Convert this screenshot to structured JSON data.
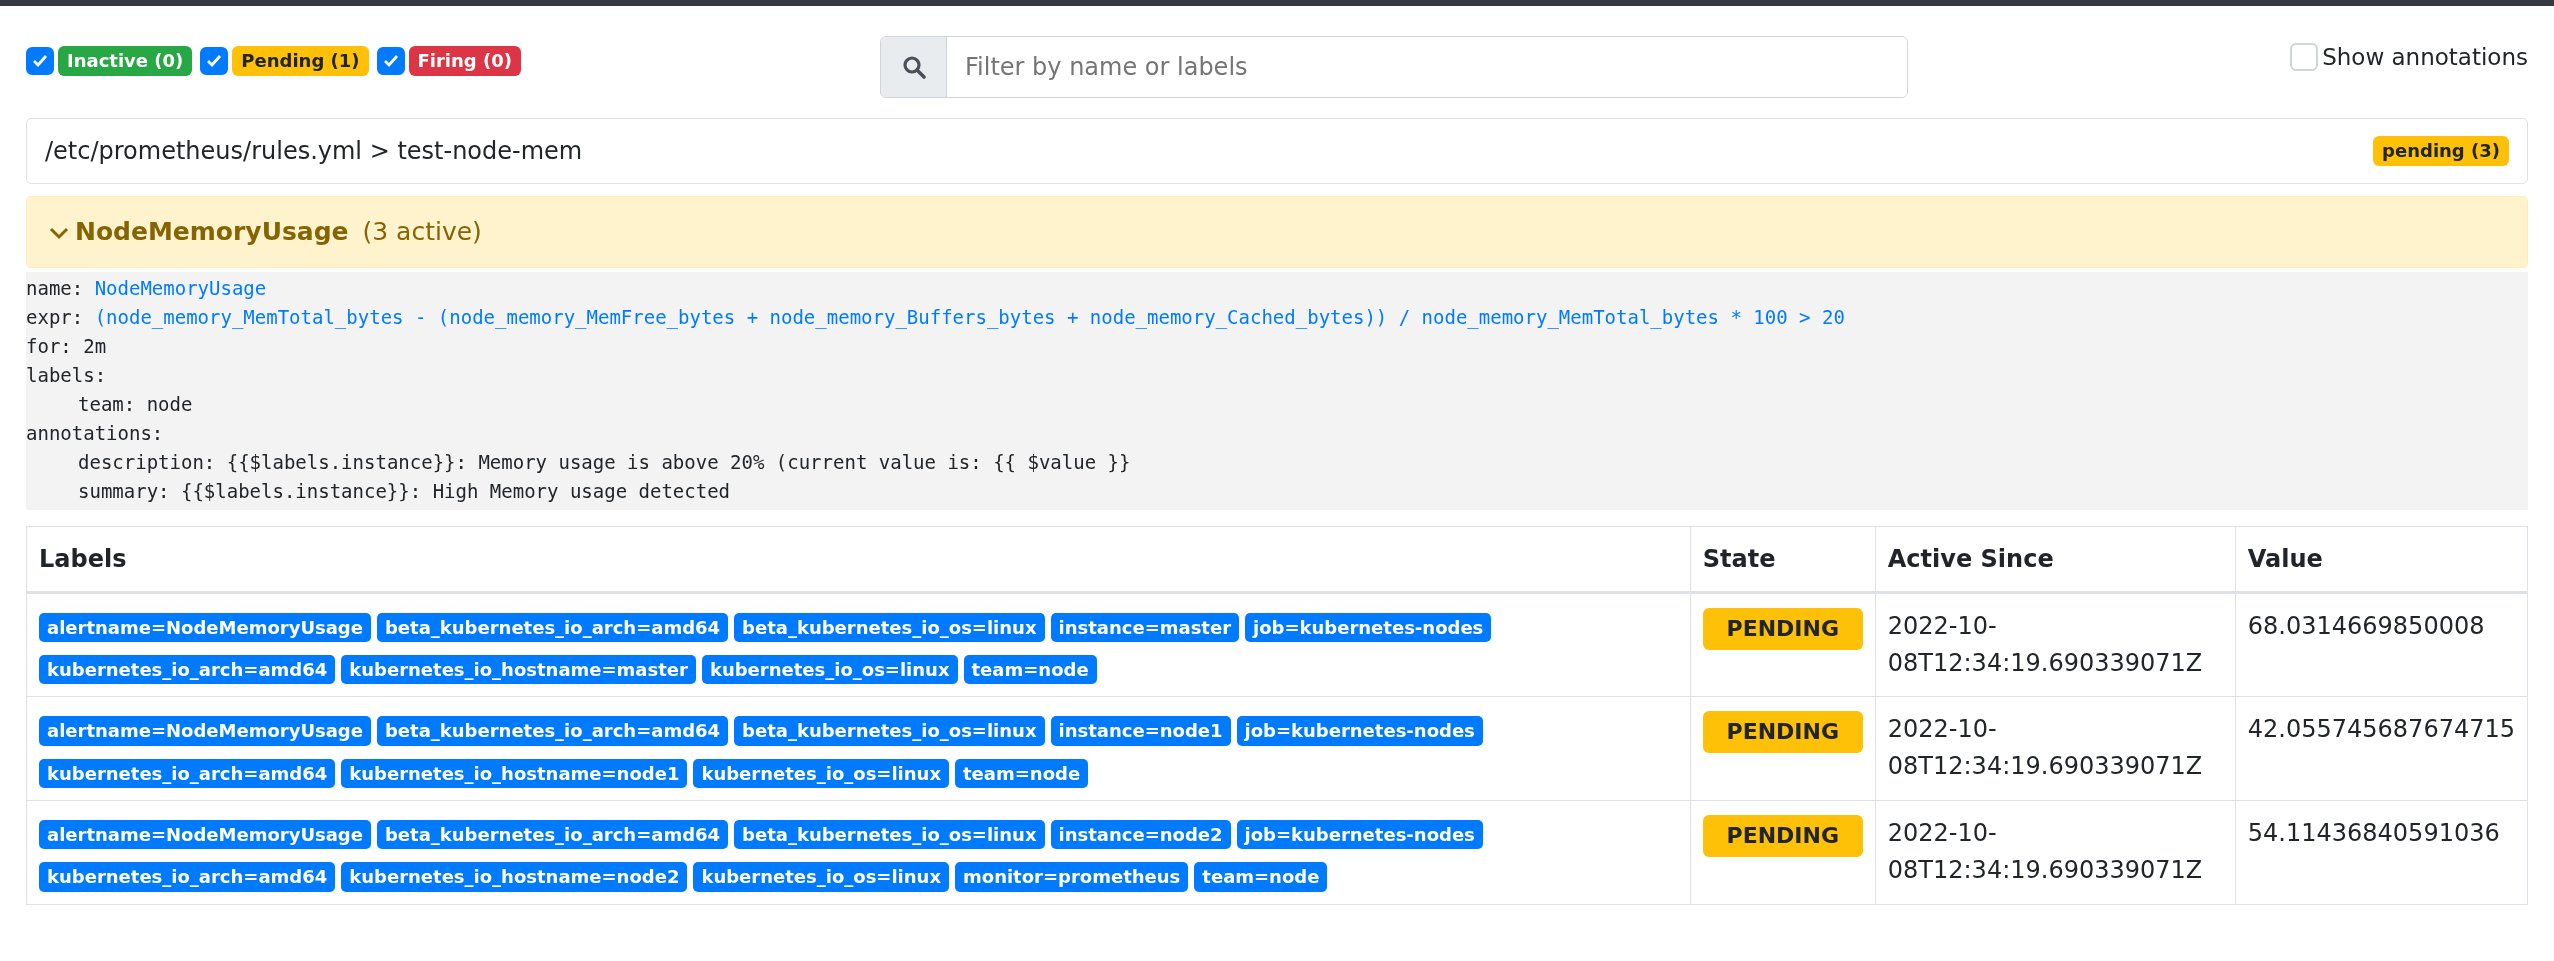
{
  "filters": [
    {
      "kind": "inactive",
      "label": "Inactive (0)",
      "checked": true
    },
    {
      "kind": "pending",
      "label": "Pending (1)",
      "checked": true
    },
    {
      "kind": "firing",
      "label": "Firing (0)",
      "checked": true
    }
  ],
  "search": {
    "placeholder": "Filter by name or labels"
  },
  "show_annotations": {
    "label": "Show annotations",
    "checked": false
  },
  "rule_group": {
    "title": "/etc/prometheus/rules.yml > test-node-mem",
    "badge": {
      "text": "pending (3)",
      "kind": "pending"
    }
  },
  "alert": {
    "name": "NodeMemoryUsage",
    "count": "(3 active)",
    "kind": "pending",
    "expanded": true,
    "definition": [
      {
        "key": "name:",
        "value": "NodeMemoryUsage",
        "highlighted": true
      },
      {
        "key": "expr:",
        "value": "(node_memory_MemTotal_bytes - (node_memory_MemFree_bytes + node_memory_Buffers_bytes + node_memory_Cached_bytes)) / node_memory_MemTotal_bytes * 100 > 20",
        "highlighted": true
      },
      {
        "key": "for:",
        "value": "2m",
        "highlighted": false
      },
      {
        "key": "labels:",
        "children": [
          {
            "key": "team:",
            "value": "node",
            "highlighted": false
          }
        ]
      },
      {
        "key": "annotations:",
        "children": [
          {
            "key": "description:",
            "value": "{{$labels.instance}}: Memory usage is above 20% (current value is: {{ $value }}",
            "highlighted": false
          },
          {
            "key": "summary:",
            "value": "{{$labels.instance}}: High Memory usage detected",
            "highlighted": false
          }
        ]
      }
    ]
  },
  "table": {
    "columns": [
      "Labels",
      "State",
      "Active Since",
      "Value"
    ],
    "rows": [
      {
        "labels": [
          "alertname=NodeMemoryUsage",
          "beta_kubernetes_io_arch=amd64",
          "beta_kubernetes_io_os=linux",
          "instance=master",
          "job=kubernetes-nodes",
          "kubernetes_io_arch=amd64",
          "kubernetes_io_hostname=master",
          "kubernetes_io_os=linux",
          "team=node"
        ],
        "state": {
          "text": "PENDING",
          "kind": "pending"
        },
        "active_since": "2022-10-08T12:34:19.690339071Z",
        "value": "68.0314669850008"
      },
      {
        "labels": [
          "alertname=NodeMemoryUsage",
          "beta_kubernetes_io_arch=amd64",
          "beta_kubernetes_io_os=linux",
          "instance=node1",
          "job=kubernetes-nodes",
          "kubernetes_io_arch=amd64",
          "kubernetes_io_hostname=node1",
          "kubernetes_io_os=linux",
          "team=node"
        ],
        "state": {
          "text": "PENDING",
          "kind": "pending"
        },
        "active_since": "2022-10-08T12:34:19.690339071Z",
        "value": "42.055745687674715"
      },
      {
        "labels": [
          "alertname=NodeMemoryUsage",
          "beta_kubernetes_io_arch=amd64",
          "beta_kubernetes_io_os=linux",
          "instance=node2",
          "job=kubernetes-nodes",
          "kubernetes_io_arch=amd64",
          "kubernetes_io_hostname=node2",
          "kubernetes_io_os=linux",
          "monitor=prometheus",
          "team=node"
        ],
        "state": {
          "text": "PENDING",
          "kind": "pending"
        },
        "active_since": "2022-10-08T12:34:19.690339071Z",
        "value": "54.11436840591036"
      }
    ]
  }
}
